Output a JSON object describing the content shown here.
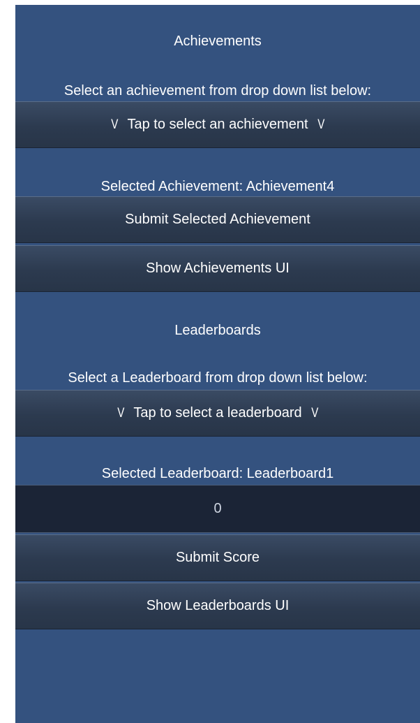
{
  "achievements": {
    "heading": "Achievements",
    "instruction": "Select an achievement from drop down list below:",
    "dropdown_chevron_left": "V",
    "dropdown_text": "Tap to select an achievement",
    "dropdown_chevron_right": "V",
    "selected_text": "Selected Achievement: Achievement4",
    "submit_label": "Submit Selected Achievement",
    "show_ui_label": "Show Achievements UI"
  },
  "leaderboards": {
    "heading": "Leaderboards",
    "instruction": "Select a Leaderboard from drop down list below:",
    "dropdown_chevron_left": "V",
    "dropdown_text": "Tap to select a leaderboard",
    "dropdown_chevron_right": "V",
    "selected_text": "Selected Leaderboard: Leaderboard1",
    "score_value": "0",
    "submit_label": "Submit Score",
    "show_ui_label": "Show Leaderboards UI"
  },
  "colors": {
    "panel_background": "#34527f",
    "button_background": "#2c3a4f",
    "input_background": "#1b2436",
    "text": "#ffffff"
  }
}
